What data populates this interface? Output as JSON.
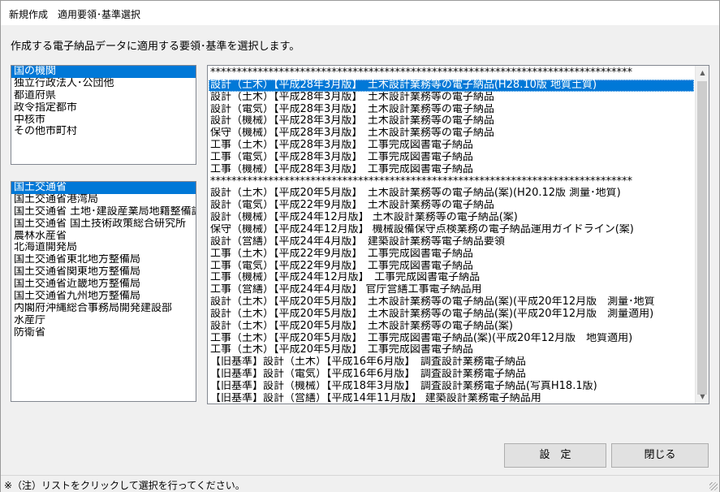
{
  "window": {
    "title": "新規作成　適用要領･基準選択"
  },
  "instruction": "作成する電子納品データに適用する要領･基準を選択します。",
  "org_list": {
    "items": [
      "国の機関",
      "独立行政法人･公団他",
      "都道府県",
      "政令指定都市",
      "中核市",
      "その他市町村"
    ],
    "selected_index": 0
  },
  "dept_list": {
    "items": [
      "国土交通省",
      "国土交通省港湾局",
      "国土交通省 土地･建設産業局地籍整備課",
      "国土交通省 国土技術政策総合研究所",
      "農林水産省",
      "北海道開発局",
      "国土交通省東北地方整備局",
      "国土交通省関東地方整備局",
      "国土交通省近畿地方整備局",
      "国土交通省九州地方整備局",
      "内閣府沖縄総合事務局開発建設部",
      "水産庁",
      "防衛省"
    ],
    "selected_index": 0
  },
  "standards_list": {
    "items": [
      "********************************************************************************",
      "設計（土木）【平成28年3月版】　土木設計業務等の電子納品(H28.10版 地質土質)",
      "設計（土木）【平成28年3月版】　土木設計業務等の電子納品",
      "設計（電気）【平成28年3月版】　土木設計業務等の電子納品",
      "設計（機械）【平成28年3月版】　土木設計業務等の電子納品",
      "保守（機械）【平成28年3月版】　土木設計業務等の電子納品",
      "工事（土木）【平成28年3月版】　工事完成図書電子納品",
      "工事（電気）【平成28年3月版】　工事完成図書電子納品",
      "工事（機械）【平成28年3月版】　工事完成図書電子納品",
      "********************************************************************************",
      "設計（土木）【平成20年5月版】　土木設計業務等の電子納品(案)(H20.12版 測量･地質)",
      "設計（電気）【平成22年9月版】　土木設計業務等の電子納品",
      "設計（機械）【平成24年12月版】 土木設計業務等の電子納品(案)",
      "保守（機械）【平成24年12月版】 機械設備保守点検業務の電子納品運用ガイドライン(案)",
      "設計（営繕）【平成24年4月版】　建築設計業務等電子納品要領",
      "工事（土木）【平成22年9月版】　工事完成図書電子納品",
      "工事（電気）【平成22年9月版】　工事完成図書電子納品",
      "工事（機械）【平成24年12月版】　工事完成図書電子納品",
      "工事（営繕）【平成24年4月版】 官庁営繕工事電子納品用",
      "設計（土木）【平成20年5月版】　土木設計業務等の電子納品(案)(平成20年12月版　測量･地質",
      "設計（土木）【平成20年5月版】　土木設計業務等の電子納品(案)(平成20年12月版　測量適用)",
      "設計（土木）【平成20年5月版】　土木設計業務等の電子納品(案)",
      "工事（土木）【平成20年5月版】　工事完成図書電子納品(案)(平成20年12月版　地質適用)",
      "工事（土木）【平成20年5月版】　工事完成図書電子納品",
      "【旧基準】設計（土木）【平成16年6月版】　調査設計業務電子納品",
      "【旧基準】設計（電気）【平成16年6月版】　調査設計業務電子納品",
      "【旧基準】設計（機械）【平成18年3月版】　調査設計業務電子納品(写真H18.1版)",
      "【旧基準】設計（営繕）【平成14年11月版】 建築設計業務電子納品用"
    ],
    "selected_index": 1
  },
  "buttons": {
    "set": "設　定",
    "close": "閉じる"
  },
  "status": "※（注）リストをクリックして選択を行ってください。"
}
